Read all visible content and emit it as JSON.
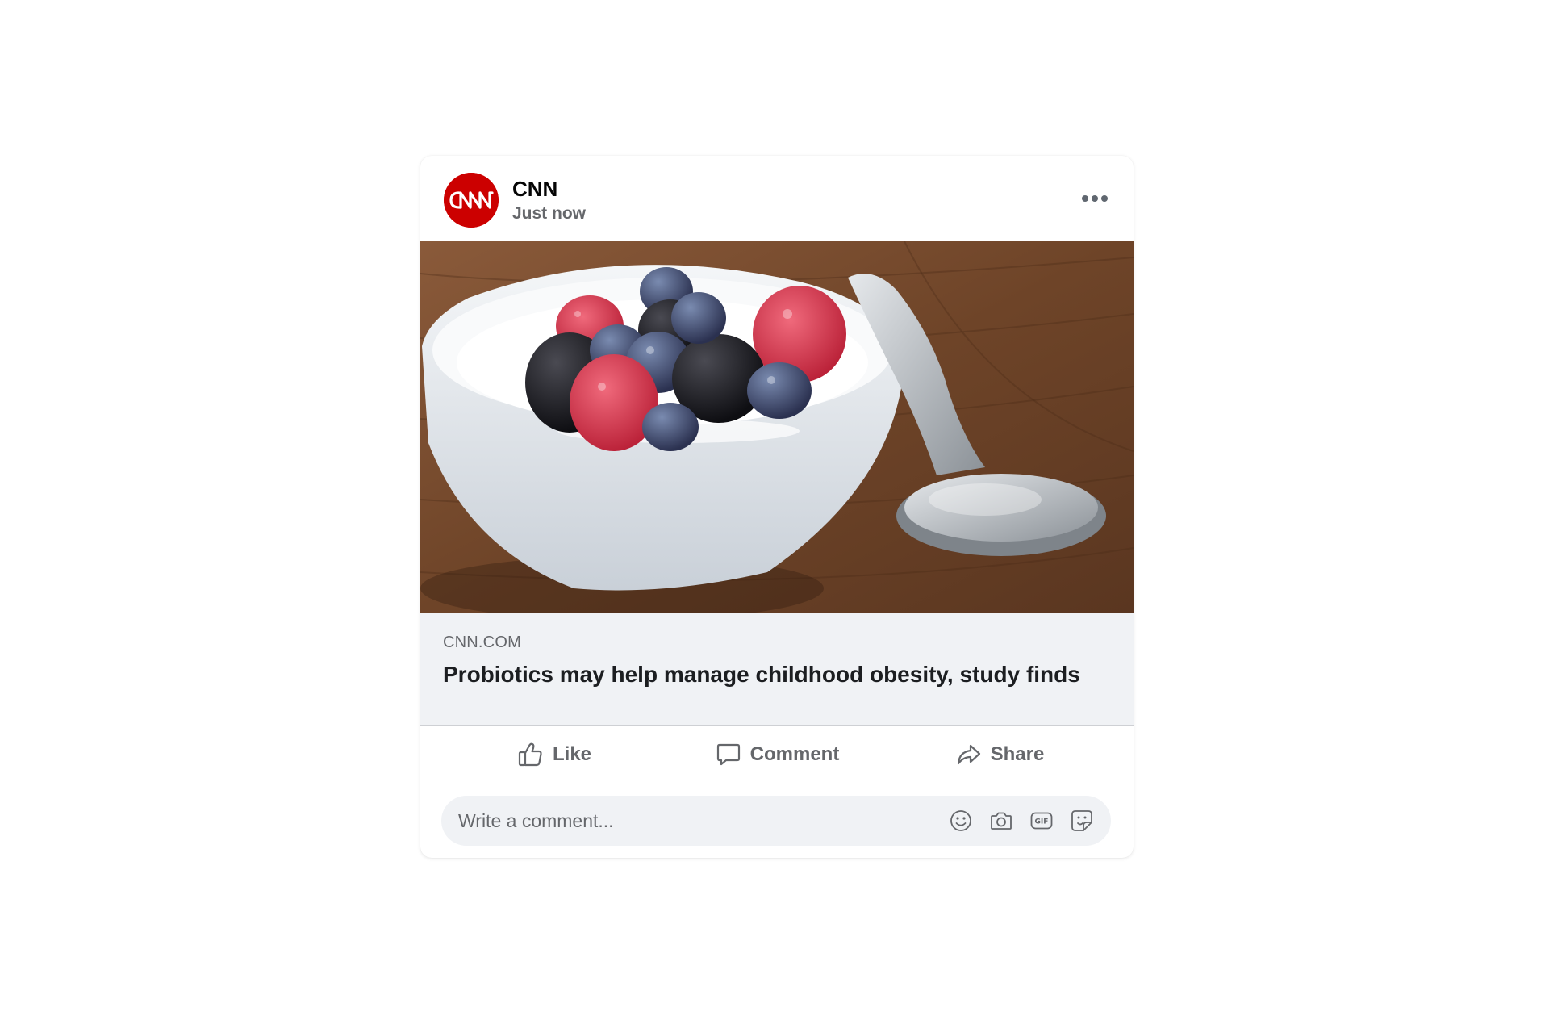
{
  "post": {
    "page_name": "CNN",
    "timestamp": "Just now",
    "avatar_logo_text": "CNN",
    "more_icon": "more-horizontal-icon",
    "image_icon": "yogurt-berries-photo"
  },
  "link_preview": {
    "domain": "CNN.COM",
    "title": "Probiotics may help manage childhood obesity, study finds"
  },
  "actions": {
    "like_label": "Like",
    "comment_label": "Comment",
    "share_label": "Share",
    "like_icon": "thumbs-up-icon",
    "comment_icon": "speech-bubble-icon",
    "share_icon": "share-arrow-icon"
  },
  "comment_box": {
    "placeholder": "Write a comment...",
    "icons": [
      "emoji-icon",
      "camera-icon",
      "gif-icon",
      "sticker-icon"
    ]
  },
  "colors": {
    "brand_red": "#cc0000",
    "secondary_text": "#65676b",
    "preview_bg": "#f0f2f5"
  }
}
